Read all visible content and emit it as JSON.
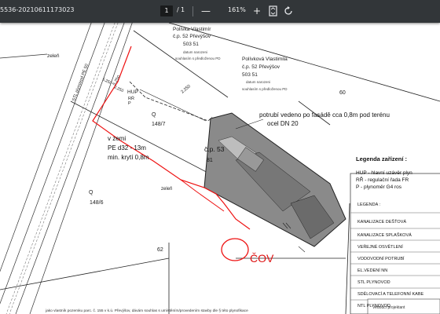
{
  "toolbar": {
    "title": "5536-20210611173023",
    "page_current": "1",
    "page_separator": "/",
    "page_total": "1",
    "zoom_out": "—",
    "zoom": "161%",
    "zoom_in": "+",
    "fit_icon": "fit-to-page-icon",
    "rotate_icon": "rotate-icon"
  },
  "map": {
    "owner1_name": "Polívka Vlastimír",
    "owner1_addr": "č.p. 52 Převýšov",
    "owner1_zip": "503 51",
    "owner1_date": "datum narozeni",
    "owner1_consent": "souhlasím s předloženou PD",
    "owner2_name": "Polívková Vlastimila",
    "owner2_addr": "č.p. 52 Převýšov",
    "owner2_zip": "503 51",
    "owner2_date": "datum narozeni",
    "owner2_consent": "souhlasím s předloženou PD",
    "label_60": "60",
    "label_zelen1": "zeleň",
    "label_zelen2": "zeleň",
    "label_stl": "STL plynovod PE 50",
    "label_dim1": "5,250",
    "label_dim2": "2,250",
    "label_dim3": "5,250",
    "label_dim4": "2,250",
    "label_hup": "HUP",
    "label_rr": "RŘ",
    "label_p": "P",
    "parcel_q1": "Q",
    "parcel_148_7": "148/7",
    "note_pipe": "potrubí vedeno po fasádě cca 0,8m pod terénu",
    "note_pipe2": "ocel DN 20",
    "house_cp": "č.p. 53",
    "house_81": "81",
    "ground_v_zemi": "v zemi",
    "ground_pe": "PE d32 - 13m",
    "ground_min": "min. krytí 0,8m",
    "parcel_q2": "Q",
    "parcel_148_6": "148/6",
    "label_62": "62",
    "cov_label": "ČOV",
    "footer_text": "jako vlastník pozemku parc. č. 155 v k.ú. Převýšov, dávám souhlas s umístěním/provedením stavby dle § této plynofikace",
    "stamp_label": "Vedoucí projektant"
  },
  "legend": {
    "title": "Legenda zařízení :",
    "hup": "HUP - hlavní uzávěr plyn",
    "rr": "RŘ   - regulační řada FR",
    "p": "P     - plynoměr G4 ros",
    "items": [
      "LEGENDA :",
      "KANALIZACE DEŠŤOVÁ",
      "KANALIZACE SPLAŠKOVÁ",
      "VEŘEJNÉ OSVĚTLENÍ",
      "VODOVODNÍ POTRUBÍ",
      "EL.VEDENÍ  NN",
      "STL PLYNOVOD",
      "SDĚLOVACÍ A TELEFONNÍ KABE",
      "NTL PLYNOVOD"
    ]
  }
}
